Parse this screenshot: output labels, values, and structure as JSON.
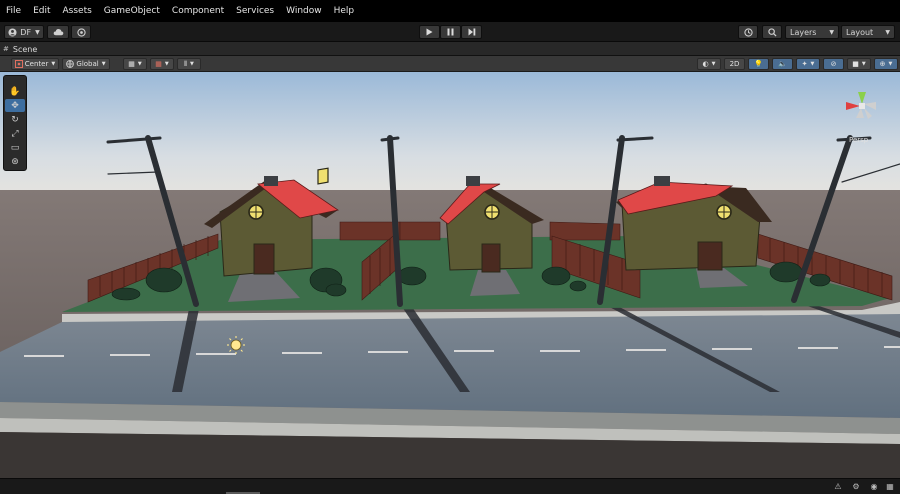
{
  "menubar": {
    "items": [
      "File",
      "Edit",
      "Assets",
      "GameObject",
      "Component",
      "Services",
      "Window",
      "Help"
    ]
  },
  "toolbar": {
    "account_label": "DF",
    "cloud_icon": "cloud-icon",
    "collab_icon": "collab-icon",
    "play_icon": "play-icon",
    "pause_icon": "pause-icon",
    "step_icon": "step-icon",
    "history_icon": "history-icon",
    "search_icon": "search-icon",
    "layers_label": "Layers",
    "layout_label": "Layout"
  },
  "scene_tab": {
    "label": "Scene"
  },
  "scene_toolbar": {
    "pivot_label": "Center",
    "space_label": "Global",
    "mode_2d_label": "2D"
  },
  "tools": [
    "hand-tool",
    "move-tool",
    "rotate-tool",
    "scale-tool",
    "rect-tool",
    "transform-tool"
  ],
  "gizmo": {
    "projection_label": "Persp"
  },
  "colors": {
    "accent": "#3d6ea0",
    "sky_top": "#9bb9d8",
    "ground": "#726865",
    "roof": "#e04848",
    "wall": "#5c5a34",
    "grass": "#3c6e4a",
    "road": "#6d7a88"
  }
}
